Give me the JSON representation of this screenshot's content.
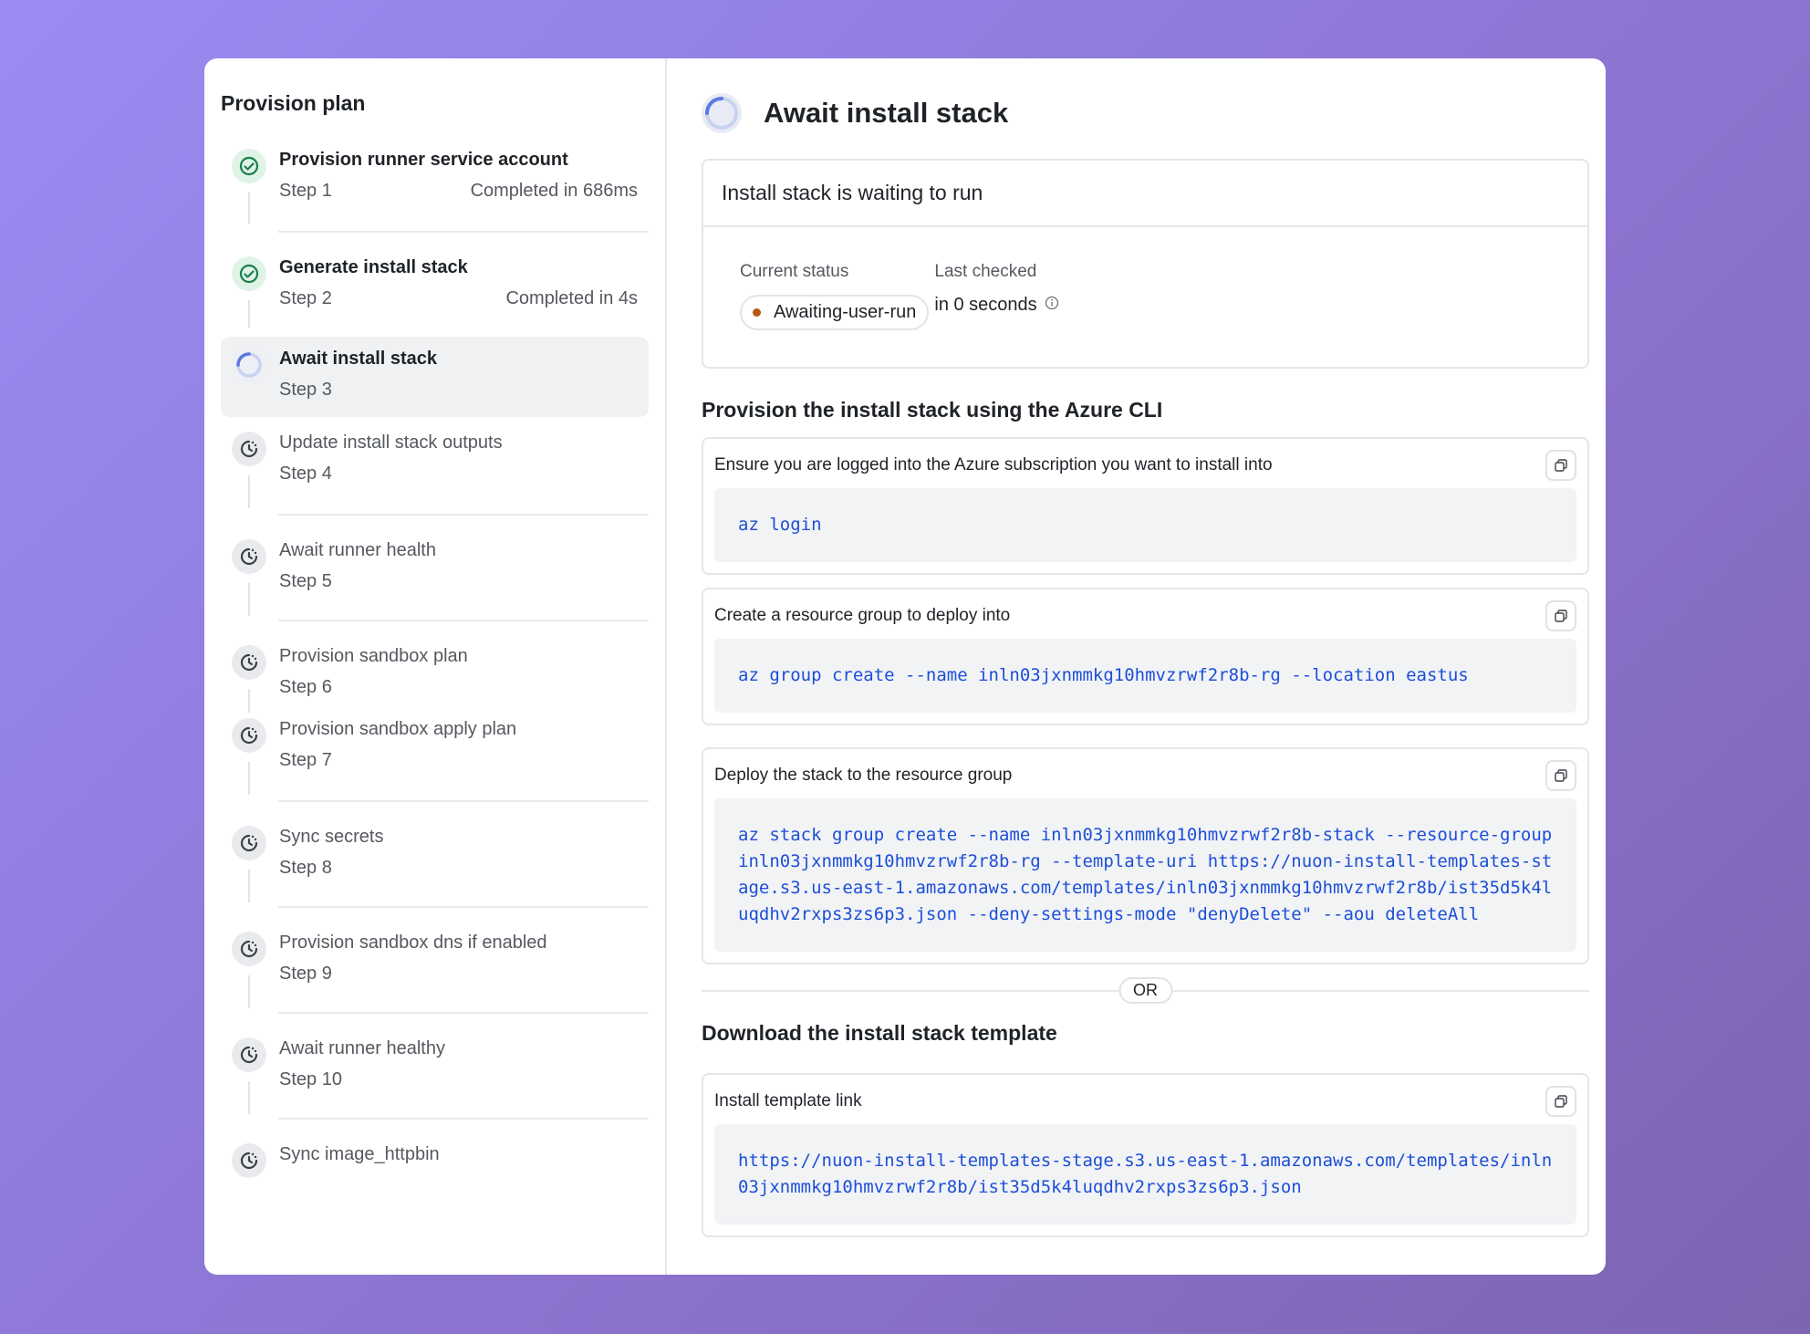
{
  "sidebar": {
    "title": "Provision plan",
    "steps": [
      {
        "label": "Provision runner service account",
        "step": "Step 1",
        "completed": "Completed in 686ms",
        "state": "done"
      },
      {
        "label": "Generate install stack",
        "step": "Step 2",
        "completed": "Completed in 4s",
        "state": "done"
      },
      {
        "label": "Await install stack",
        "step": "Step 3",
        "completed": "",
        "state": "active"
      },
      {
        "label": "Update install stack outputs",
        "step": "Step 4",
        "completed": "",
        "state": "pending"
      },
      {
        "label": "Await runner health",
        "step": "Step 5",
        "completed": "",
        "state": "pending"
      },
      {
        "label": "Provision sandbox plan",
        "step": "Step 6",
        "completed": "",
        "state": "pending"
      },
      {
        "label": "Provision sandbox apply plan",
        "step": "Step 7",
        "completed": "",
        "state": "pending"
      },
      {
        "label": "Sync secrets",
        "step": "Step 8",
        "completed": "",
        "state": "pending"
      },
      {
        "label": "Provision sandbox dns if enabled",
        "step": "Step 9",
        "completed": "",
        "state": "pending"
      },
      {
        "label": "Await runner healthy",
        "step": "Step 10",
        "completed": "",
        "state": "pending"
      },
      {
        "label": "Sync image_httpbin",
        "step": "",
        "completed": "",
        "state": "pending"
      }
    ]
  },
  "main": {
    "title": "Await install stack",
    "status_card": {
      "heading": "Install stack is waiting to run",
      "current_status_label": "Current status",
      "current_status_value": "Awaiting-user-run",
      "last_checked_label": "Last checked",
      "last_checked_value": "in 0 seconds"
    },
    "cli_section_title": "Provision the install stack using the Azure CLI",
    "commands": [
      {
        "label": "Ensure you are logged into the Azure subscription you want to install into",
        "code": "az login"
      },
      {
        "label": "Create a resource group to deploy into",
        "code": "az group create --name inln03jxnmmkg10hmvzrwf2r8b-rg --location eastus"
      },
      {
        "label": "Deploy the stack to the resource group",
        "code": "az stack group create --name inln03jxnmmkg10hmvzrwf2r8b-stack --resource-group inln03jxnmmkg10hmvzrwf2r8b-rg --template-uri https://nuon-install-templates-stage.s3.us-east-1.amazonaws.com/templates/inln03jxnmmkg10hmvzrwf2r8b/ist35d5k4luqdhv2rxps3zs6p3.json --deny-settings-mode \"denyDelete\" --aou deleteAll"
      }
    ],
    "or_label": "OR",
    "download_section_title": "Download the install stack template",
    "template_link": {
      "label": "Install template link",
      "code": "https://nuon-install-templates-stage.s3.us-east-1.amazonaws.com/templates/inln03jxnmmkg10hmvzrwf2r8b/ist35d5k4luqdhv2rxps3zs6p3.json"
    },
    "colors": {
      "link": "#1c4fd8",
      "done": "#1a7f4b",
      "badge_dot": "#b35a16"
    }
  }
}
